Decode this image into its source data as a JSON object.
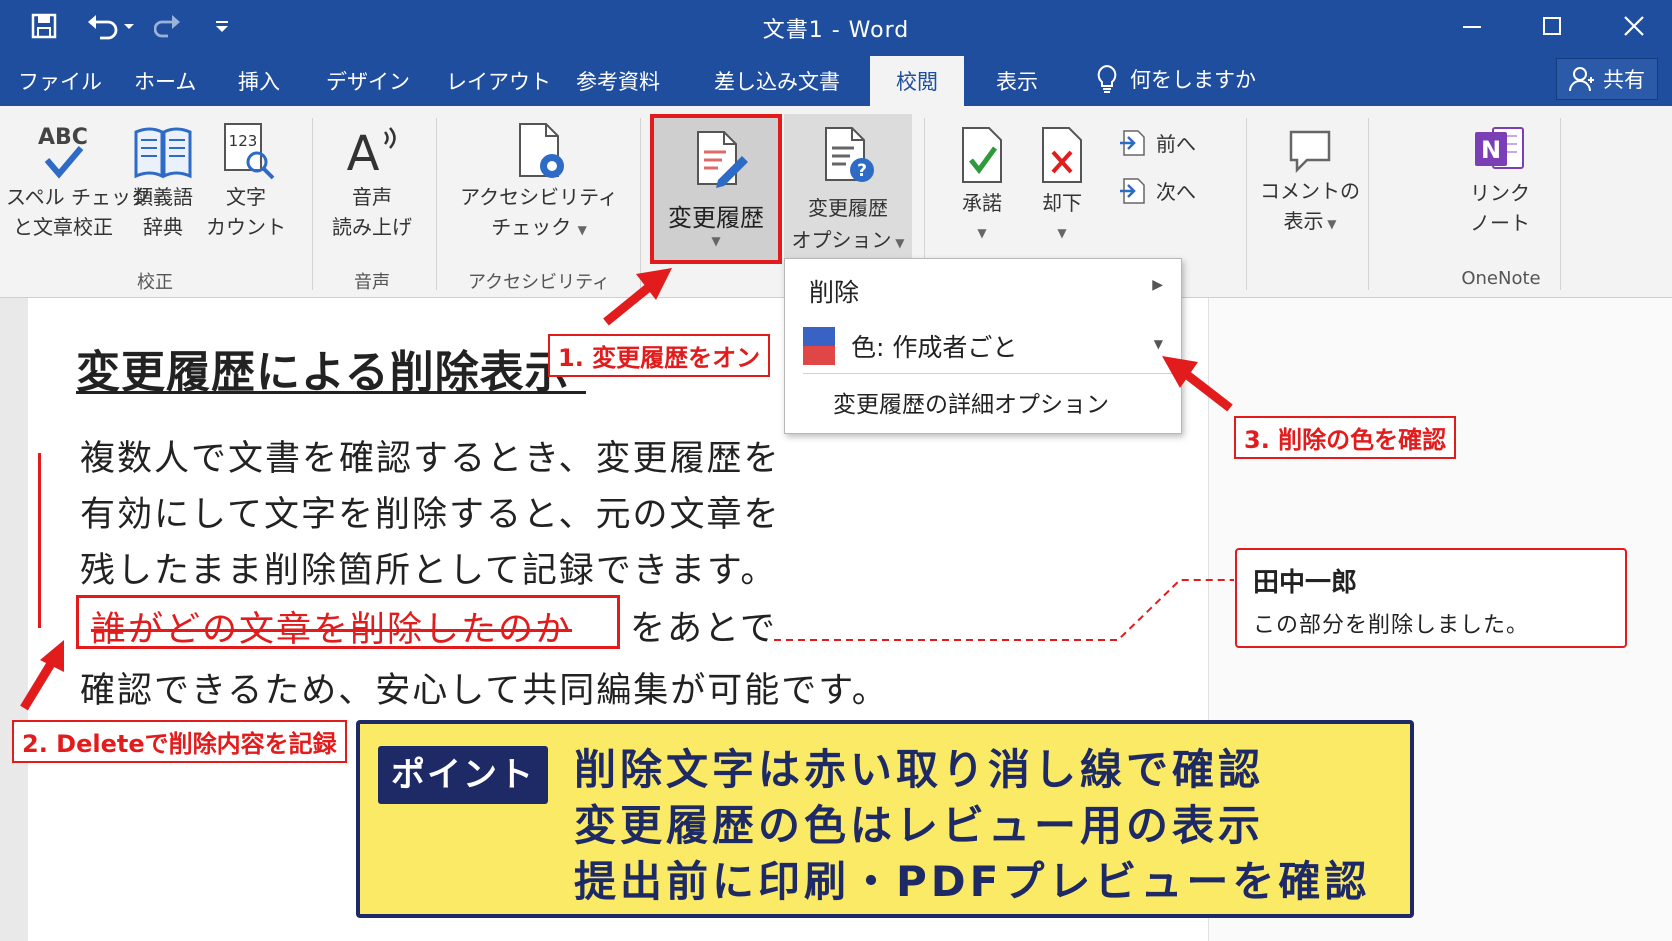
{
  "window": {
    "title": "文書1  -  Word",
    "controls": {
      "minimize": "—",
      "maximize": "☐",
      "close": "✕"
    }
  },
  "tabs": [
    "ファイル",
    "ホーム",
    "挿入",
    "デザイン",
    "レイアウト",
    "参考資料",
    "差し込み文書",
    "校閲",
    "表示"
  ],
  "active_tab": "校閲",
  "tell_me": "何をしますか",
  "share": "共有",
  "ribbon": {
    "proofing": {
      "spell_line1": "スペル チェック",
      "spell_line2": "と文章校正",
      "spell_icon_text": "ABC",
      "thesaurus_line1": "類義語",
      "thesaurus_line2": "辞典",
      "wordcount_line1": "文字",
      "wordcount_line2": "カウント",
      "wordcount_icon_text": "123",
      "group": "校正"
    },
    "speech": {
      "line1": "音声",
      "line2": "読み上げ",
      "group": "音声",
      "icon_text": "A"
    },
    "accessibility": {
      "line1": "アクセシビリティ",
      "line2": "チェック",
      "group": "アクセシビリティ"
    },
    "tracking": {
      "track_changes": "変更履歴",
      "options_line1": "変更履歴",
      "options_line2": "オプション"
    },
    "changes": {
      "accept": "承諾",
      "reject": "却下",
      "previous": "前へ",
      "next": "次へ"
    },
    "comments": {
      "line1": "コメントの",
      "line2": "表示"
    },
    "onenote": {
      "line1": "リンク",
      "line2": "ノート",
      "group": "OneNote",
      "icon_text": "N"
    }
  },
  "dropdown": {
    "items": [
      "削除",
      "色: 作成者ごと",
      "変更履歴の詳細オプション"
    ]
  },
  "document": {
    "heading": "変更履歴による削除表示",
    "lines": [
      "複数人で文書を確認するとき、変更履歴を",
      "有効にして文字を削除すると、元の文章を",
      "残したまま削除箇所として記録できます。"
    ],
    "deleted_text": "誰がどの文章を削除したのか",
    "after_deleted": "をあとで",
    "last_line": "確認できるため、安心して共同編集が可能です。"
  },
  "comment": {
    "author": "田中一郎",
    "text": "この部分を削除しました。"
  },
  "callouts": {
    "step1": "1. 変更履歴をオン",
    "step2": "2. Deleteで削除内容を記録",
    "step3": "3. 削除の色を確認"
  },
  "point": {
    "badge": "ポイント",
    "lines": [
      "削除文字は赤い取り消し線で確認",
      "変更履歴の色はレビュー用の表示",
      "提出前に印刷・PDFプレビューを確認"
    ]
  },
  "colors": {
    "titlebar": "#1f4e9e",
    "accent_red": "#e21c1c",
    "point_bg": "#fbea66",
    "point_navy": "#1e2a66"
  }
}
